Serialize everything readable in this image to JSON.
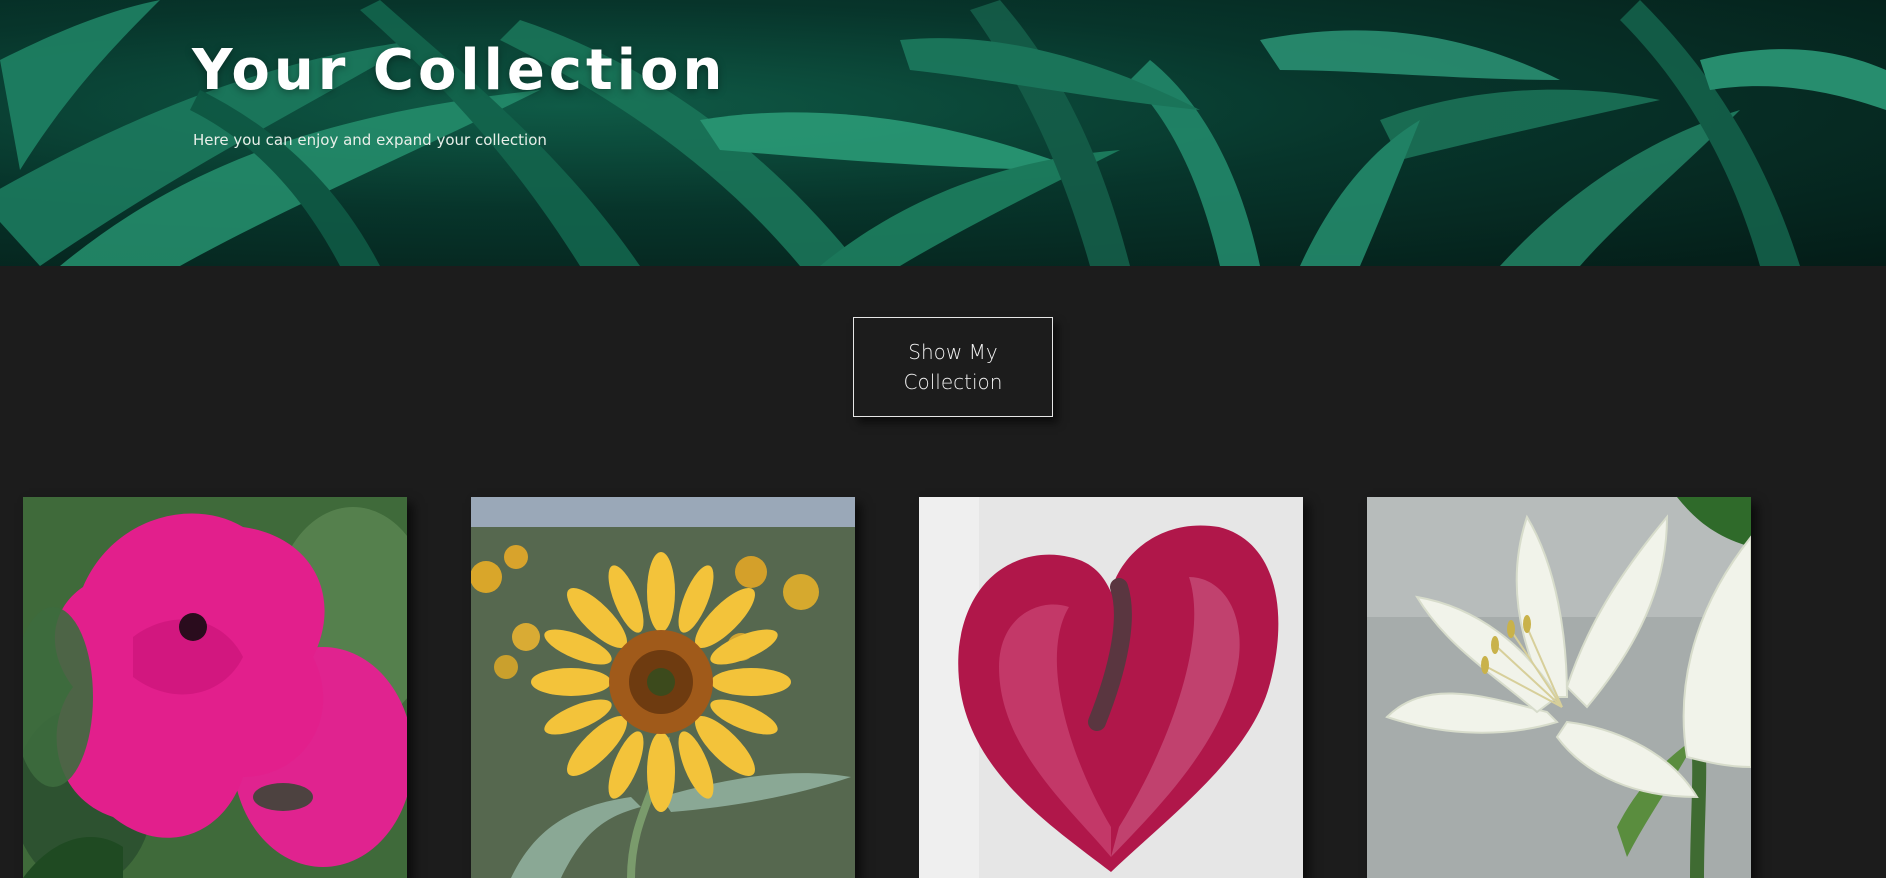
{
  "hero": {
    "title": "Your Collection",
    "subtitle": "Here you can enjoy and expand your collection",
    "background_color": "#07352b"
  },
  "actions": {
    "show_collection_label": "Show My Collection"
  },
  "gallery": {
    "items": [
      {
        "name": "pink-petunia",
        "accent": "#e0238f"
      },
      {
        "name": "sunflower",
        "accent": "#f1c232"
      },
      {
        "name": "red-anthurium",
        "accent": "#b0174a"
      },
      {
        "name": "white-lily",
        "accent": "#eef1e6"
      }
    ]
  },
  "colors": {
    "page_background": "#1c1c1c",
    "text": "#ffffff",
    "button_border": "#e6e6e6"
  }
}
